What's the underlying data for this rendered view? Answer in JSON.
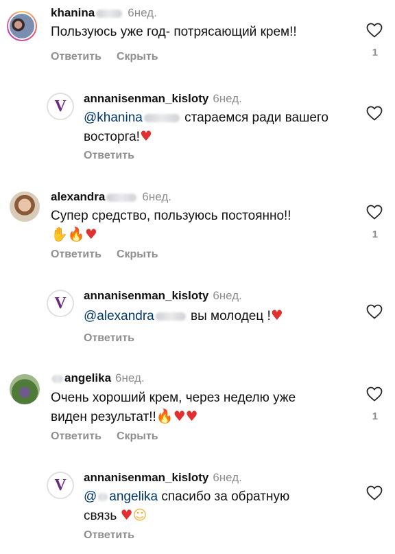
{
  "comments": [
    {
      "user": "khanina",
      "time": "6нед.",
      "text": "Пользуюсь уже год- потрясающий крем!!",
      "reply_label": "Ответить",
      "hide_label": "Скрыть",
      "likes": "1"
    },
    {
      "user": "annanisenman_kisloty",
      "time": "6нед.",
      "mention": "@khanina",
      "text": "стараемся ради вашего",
      "text2": "восторга!",
      "reply_label": "Ответить"
    },
    {
      "user": "alexandra",
      "time": "6нед.",
      "text": "Супер средство, пользуюсь постоянно!!",
      "reply_label": "Ответить",
      "hide_label": "Скрыть",
      "likes": "1"
    },
    {
      "user": "annanisenman_kisloty",
      "time": "6нед.",
      "mention": "@alexandra",
      "text": "вы молодец !",
      "reply_label": "Ответить"
    },
    {
      "user": "angelika",
      "time": "6нед.",
      "text": "Очень хороший крем, через неделю уже",
      "text2": "виден результат!!",
      "reply_label": "Ответить",
      "hide_label": "Скрыть",
      "likes": "1"
    },
    {
      "user": "annanisenman_kisloty",
      "time": "6нед.",
      "mention": "@angelika",
      "text": "спасибо за обратную",
      "text2": "связь",
      "reply_label": "Ответить"
    }
  ],
  "icons": {
    "heart": "heart-outline-icon",
    "brand_logo": "V"
  },
  "colors": {
    "mention": "#00376b",
    "muted": "#8e8e8e",
    "brand": "#6b2a7f"
  }
}
